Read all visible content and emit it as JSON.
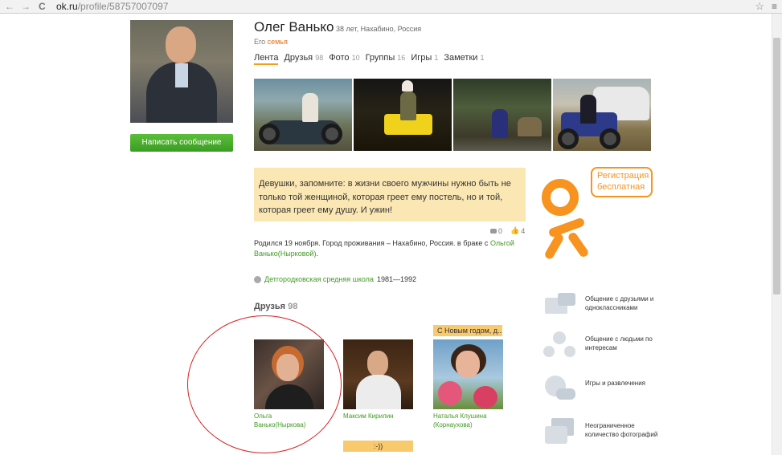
{
  "browser": {
    "url_host": "ok.ru",
    "url_path": "/profile/58757007097",
    "back_glyph": "←",
    "forward_glyph": "→",
    "reload_glyph": "C",
    "bookmark_glyph": "☆",
    "menu_glyph": "≡"
  },
  "profile": {
    "name": "Олег Ванько",
    "meta": "38 лет, Нахабино, Россия",
    "family_prefix": "Его",
    "family_link": "семья",
    "send_message": "Написать сообщение"
  },
  "tabs": [
    {
      "label": "Лента",
      "count": ""
    },
    {
      "label": "Друзья",
      "count": "98"
    },
    {
      "label": "Фото",
      "count": "10"
    },
    {
      "label": "Группы",
      "count": "16"
    },
    {
      "label": "Игры",
      "count": "1"
    },
    {
      "label": "Заметки",
      "count": "1"
    }
  ],
  "status": {
    "text": "Девушки, запомните: в жизни своего мужчины нужно быть не только той женщиной, которая греет ему постель, но и той, которая греет ему душу. И ужин!",
    "comments": "0",
    "likes": "4"
  },
  "bio": {
    "text": "Родился 19 ноября. Город проживания – Нахабино, Россия. в браке с ",
    "spouse_link": "Ольгой Ванько(Нырковой)",
    "end": "."
  },
  "school": {
    "name": "Детгородковская средняя школа",
    "years": "1981—1992"
  },
  "friends": {
    "title": "Друзья",
    "count": "98",
    "items": [
      {
        "name": "Ольга Ванько(Ныркова)",
        "bubble": ""
      },
      {
        "name": "Максим Кирилин",
        "bubble": ""
      },
      {
        "name": "Наталья Клушина (Корнаухова)",
        "bubble": "С Новым годом, д..."
      }
    ],
    "bottom_bubble": ":-))"
  },
  "promo": {
    "register": "Регистрация бесплатная",
    "features": [
      {
        "icon": "messages-icon",
        "text": "Общение с друзьями и одноклассниками"
      },
      {
        "icon": "people-interests-icon",
        "text": "Общение с людьми по интересам"
      },
      {
        "icon": "games-icon",
        "text": "Игры и развлечения"
      },
      {
        "icon": "photos-icon",
        "text": "Неограниченное количество фотографий"
      }
    ]
  },
  "colors": {
    "accent": "#f7931e",
    "link_green": "#3f9b22",
    "status_bg": "#fbe7b4",
    "button_green": "#4cae2e",
    "annotation_red": "#d81e1e"
  }
}
